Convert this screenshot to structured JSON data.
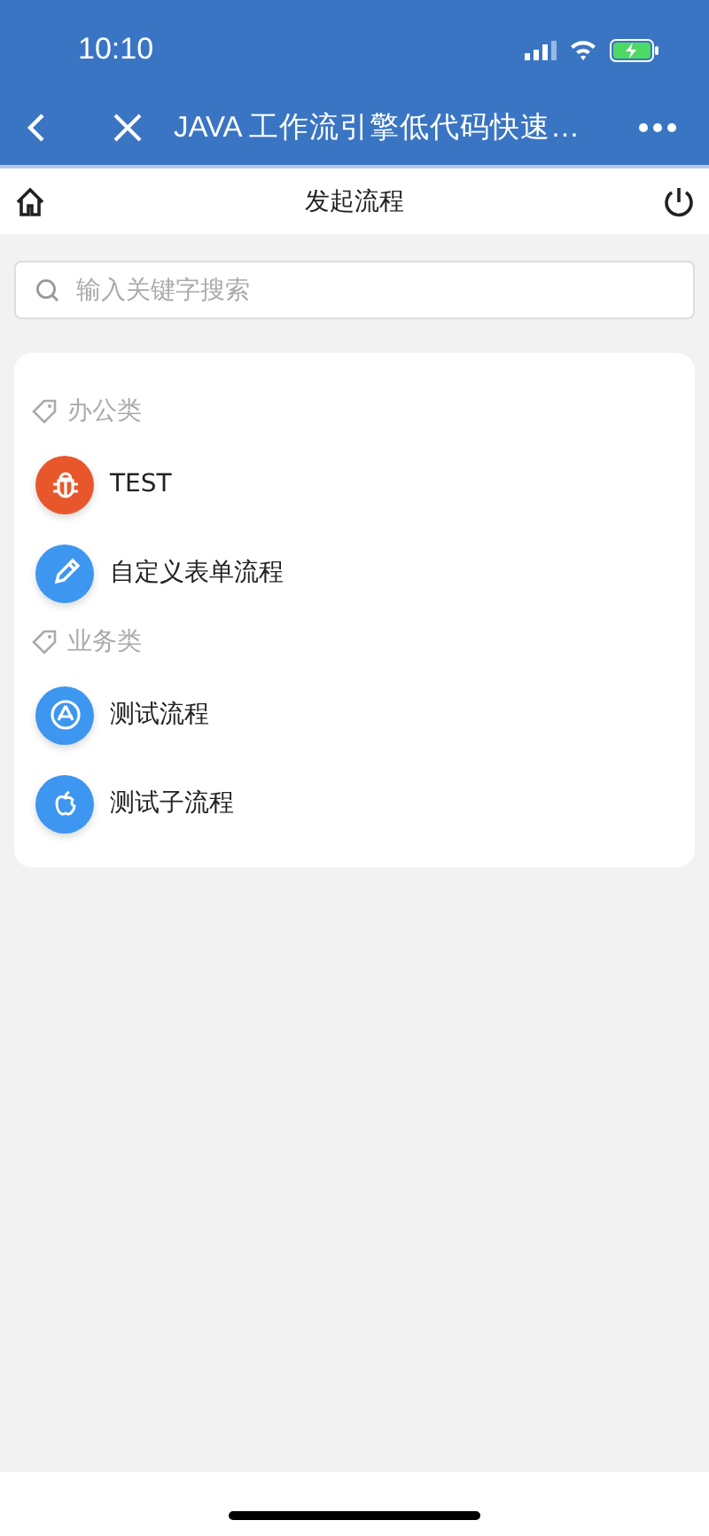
{
  "status_bar": {
    "time": "10:10"
  },
  "nav_bar": {
    "title": "JAVA 工作流引擎低代码快速…"
  },
  "header": {
    "title": "发起流程"
  },
  "search": {
    "placeholder": "输入关键字搜索"
  },
  "groups": [
    {
      "name": "办公类",
      "items": [
        {
          "label": "TEST",
          "kind": "bug",
          "color": "#e8572c"
        },
        {
          "label": "自定义表单流程",
          "kind": "pencil",
          "color": "#3d96f0"
        }
      ]
    },
    {
      "name": "业务类",
      "items": [
        {
          "label": "测试流程",
          "kind": "compass",
          "color": "#3d96f0"
        },
        {
          "label": "测试子流程",
          "kind": "fruit",
          "color": "#3d96f0"
        }
      ]
    }
  ]
}
